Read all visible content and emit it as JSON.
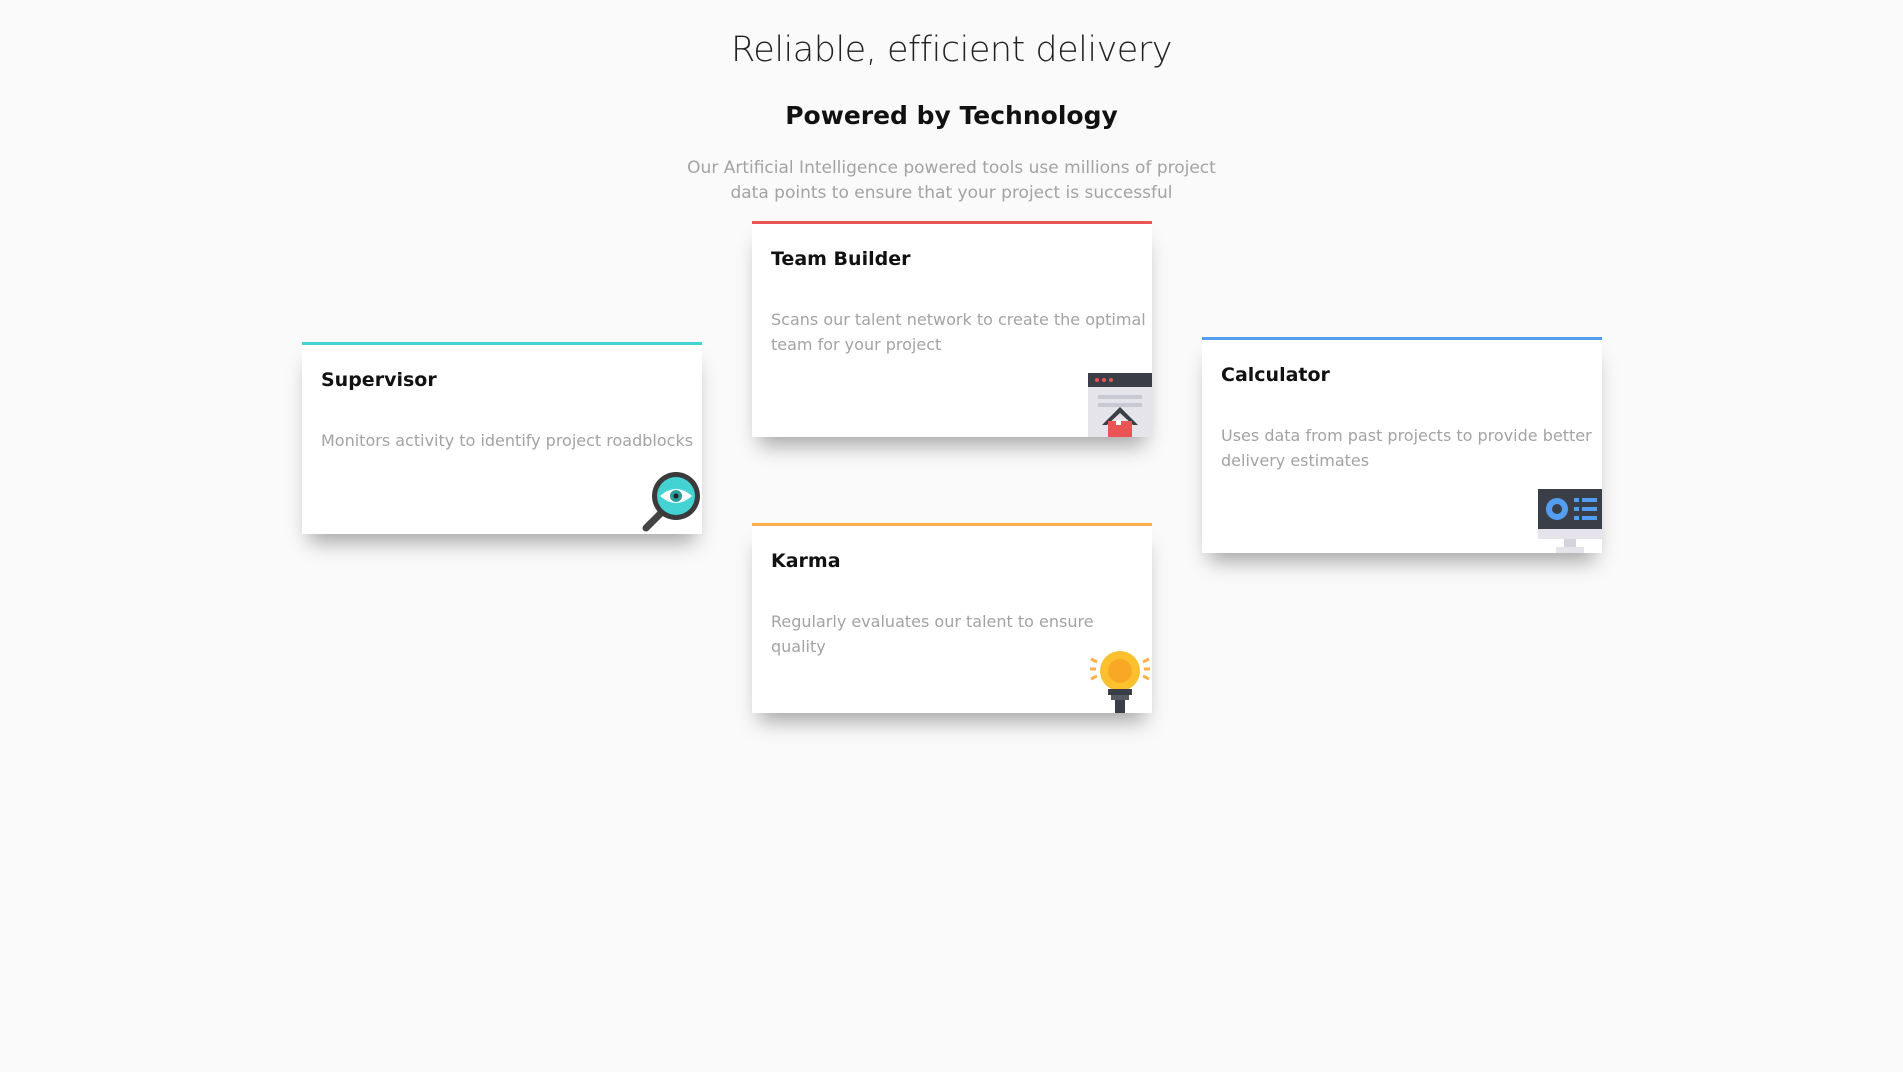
{
  "header": {
    "title": "Reliable, efficient delivery",
    "subtitle": "Powered by Technology",
    "intro": "Our Artificial Intelligence powered tools use millions of project data points to ensure that your project is successful"
  },
  "cards": [
    {
      "title": "Supervisor",
      "description": "Monitors activity to identify project roadblocks",
      "accent_color": "#44d3d2",
      "icon": "supervisor-magnifier-eye-icon"
    },
    {
      "title": "Team Builder",
      "description": "Scans our talent network to create the optimal team for your project",
      "accent_color": "#ea5454",
      "icon": "team-builder-house-window-icon"
    },
    {
      "title": "Karma",
      "description": "Regularly evaluates our talent to ensure quality",
      "accent_color": "#fcaf4a",
      "icon": "karma-lightbulb-icon"
    },
    {
      "title": "Calculator",
      "description": "Uses data from past projects to provide better delivery estimates",
      "accent_color": "#549ef2",
      "icon": "calculator-monitor-icon"
    }
  ]
}
